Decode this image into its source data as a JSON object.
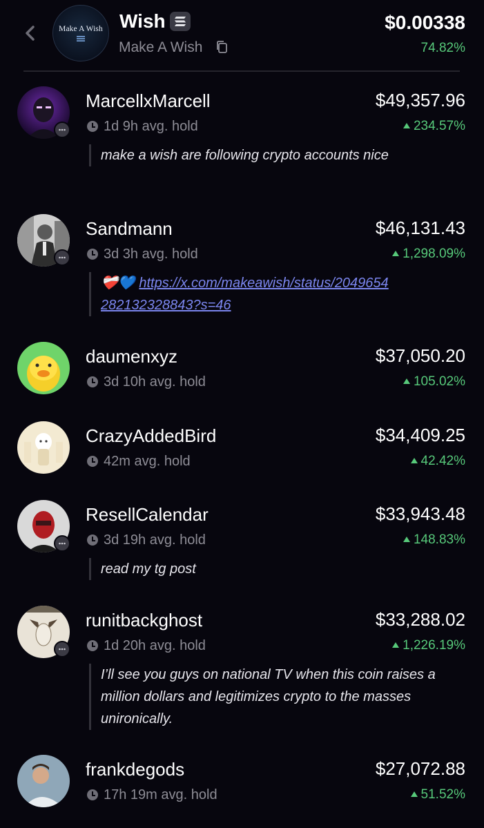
{
  "header": {
    "token_name": "Wish",
    "token_full_name": "Make A Wish",
    "logo_text": "Make A Wish",
    "price": "$0.00338",
    "price_change": "74.82%",
    "icons": [
      "chevron-left-icon",
      "solana-icon",
      "copy-icon"
    ]
  },
  "holders": [
    {
      "name": "MarcellxMarcell",
      "hold": "1d 9h avg. hold",
      "value": "$49,357.96",
      "change": "234.57%",
      "comment": "make a wish are following crypto accounts nice",
      "has_chat": true
    },
    {
      "name": "Sandmann",
      "hold": "3d 3h avg. hold",
      "value": "$46,131.43",
      "change": "1,298.09%",
      "comment_emoji": "❤️‍🩹💙",
      "comment_link": "https://x.com/makeawish/status/2049654282132328843?s=46",
      "has_chat": true
    },
    {
      "name": "daumenxyz",
      "hold": "3d 10h avg. hold",
      "value": "$37,050.20",
      "change": "105.02%",
      "has_chat": false
    },
    {
      "name": "CrazyAddedBird",
      "hold": "42m avg. hold",
      "value": "$34,409.25",
      "change": "42.42%",
      "has_chat": false
    },
    {
      "name": "ResellCalendar",
      "hold": "3d 19h avg. hold",
      "value": "$33,943.48",
      "change": "148.83%",
      "comment": "read my tg post",
      "has_chat": true
    },
    {
      "name": "runitbackghost",
      "hold": "1d 20h avg. hold",
      "value": "$33,288.02",
      "change": "1,226.19%",
      "comment": "I’ll see you guys on national TV when this coin raises a million dollars and legitimizes crypto to the masses unironically.",
      "has_chat": true
    },
    {
      "name": "frankdegods",
      "hold": "17h 19m avg. hold",
      "value": "$27,072.88",
      "change": "51.52%",
      "has_chat": false
    }
  ],
  "colors": {
    "background": "#07060e",
    "positive": "#57c97a",
    "muted": "#8e8d96",
    "link": "#7b86ef"
  }
}
